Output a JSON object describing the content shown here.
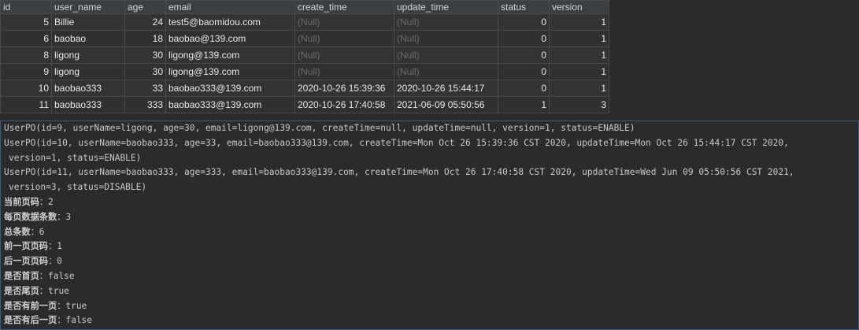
{
  "table": {
    "columns": [
      "id",
      "user_name",
      "age",
      "email",
      "create_time",
      "update_time",
      "status",
      "version"
    ],
    "rows": [
      {
        "id": "5",
        "user_name": "Billie",
        "age": "24",
        "email": "test5@baomidou.com",
        "create_time": "(Null)",
        "update_time": "(Null)",
        "status": "0",
        "version": "1"
      },
      {
        "id": "6",
        "user_name": "baobao",
        "age": "18",
        "email": "baobao@139.com",
        "create_time": "(Null)",
        "update_time": "(Null)",
        "status": "0",
        "version": "1"
      },
      {
        "id": "8",
        "user_name": "ligong",
        "age": "30",
        "email": "ligong@139.com",
        "create_time": "(Null)",
        "update_time": "(Null)",
        "status": "0",
        "version": "1"
      },
      {
        "id": "9",
        "user_name": "ligong",
        "age": "30",
        "email": "ligong@139.com",
        "create_time": "(Null)",
        "update_time": "(Null)",
        "status": "0",
        "version": "1"
      },
      {
        "id": "10",
        "user_name": "baobao333",
        "age": "33",
        "email": "baobao333@139.com",
        "create_time": "2020-10-26 15:39:36",
        "update_time": "2020-10-26 15:44:17",
        "status": "0",
        "version": "1"
      },
      {
        "id": "11",
        "user_name": "baobao333",
        "age": "333",
        "email": "baobao333@139.com",
        "create_time": "2020-10-26 17:40:58",
        "update_time": "2021-06-09 05:50:56",
        "status": "1",
        "version": "3"
      }
    ]
  },
  "console": {
    "lines": [
      {
        "text": "UserPO(id=9, userName=ligong, age=30, email=ligong@139.com, createTime=null, updateTime=null, version=1, status=ENABLE)"
      },
      {
        "text": "UserPO(id=10, userName=baobao333, age=33, email=baobao333@139.com, createTime=Mon Oct 26 15:39:36 CST 2020, updateTime=Mon Oct 26 15:44:17 CST 2020,"
      },
      {
        "text": "version=1, status=ENABLE)",
        "indent": true
      },
      {
        "text": "UserPO(id=11, userName=baobao333, age=333, email=baobao333@139.com, createTime=Mon Oct 26 17:40:58 CST 2020, updateTime=Wed Jun 09 05:50:56 CST 2021,"
      },
      {
        "text": "version=3, status=DISABLE)",
        "indent": true
      },
      {
        "label": "当前页码",
        "value": "2"
      },
      {
        "label": "每页数据条数",
        "value": "3"
      },
      {
        "label": "总条数",
        "value": "6"
      },
      {
        "label": "前一页页码",
        "value": "1"
      },
      {
        "label": "后一页页码",
        "value": "0"
      },
      {
        "label": "是否首页",
        "value": "false"
      },
      {
        "label": "是否尾页",
        "value": "true"
      },
      {
        "label": "是否有前一页",
        "value": "true"
      },
      {
        "label": "是否有后一页",
        "value": "false"
      }
    ],
    "separator": "："
  }
}
